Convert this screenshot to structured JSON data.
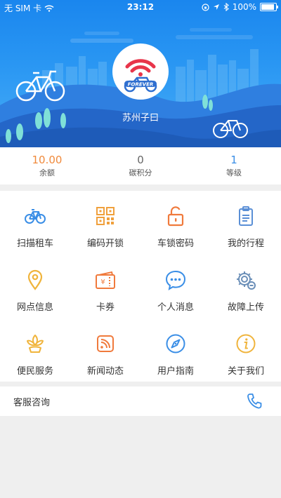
{
  "status_bar": {
    "carrier": "无 SIM 卡",
    "time": "23:12",
    "battery": "100%",
    "battery_level": 1.0
  },
  "profile": {
    "username": "苏州子曰",
    "avatar_logo_text": "FOREVER"
  },
  "stats": [
    {
      "value": "10.00",
      "label": "余额",
      "color": "#f08a3c"
    },
    {
      "value": "0",
      "label": "碳积分",
      "color": "#666666"
    },
    {
      "value": "1",
      "label": "等级",
      "color": "#3a8ee6"
    }
  ],
  "menu": [
    {
      "label": "扫描租车",
      "icon": "bicycle-icon"
    },
    {
      "label": "编码开锁",
      "icon": "qr-code-icon"
    },
    {
      "label": "车锁密码",
      "icon": "unlock-icon"
    },
    {
      "label": "我的行程",
      "icon": "clipboard-icon"
    },
    {
      "label": "网点信息",
      "icon": "location-pin-icon"
    },
    {
      "label": "卡券",
      "icon": "ticket-icon"
    },
    {
      "label": "个人消息",
      "icon": "chat-bubble-icon"
    },
    {
      "label": "故障上传",
      "icon": "gear-settings-icon"
    },
    {
      "label": "便民服务",
      "icon": "flower-icon"
    },
    {
      "label": "新闻动态",
      "icon": "rss-feed-icon"
    },
    {
      "label": "用户指南",
      "icon": "compass-icon"
    },
    {
      "label": "关于我们",
      "icon": "info-icon"
    }
  ],
  "customer_service": {
    "label": "客服咨询",
    "icon": "phone-icon"
  },
  "colors": {
    "blue": "#3a8ee6",
    "orange": "#f08a3c",
    "yellow": "#f0b43c",
    "header_blue": "#1a86ee"
  }
}
